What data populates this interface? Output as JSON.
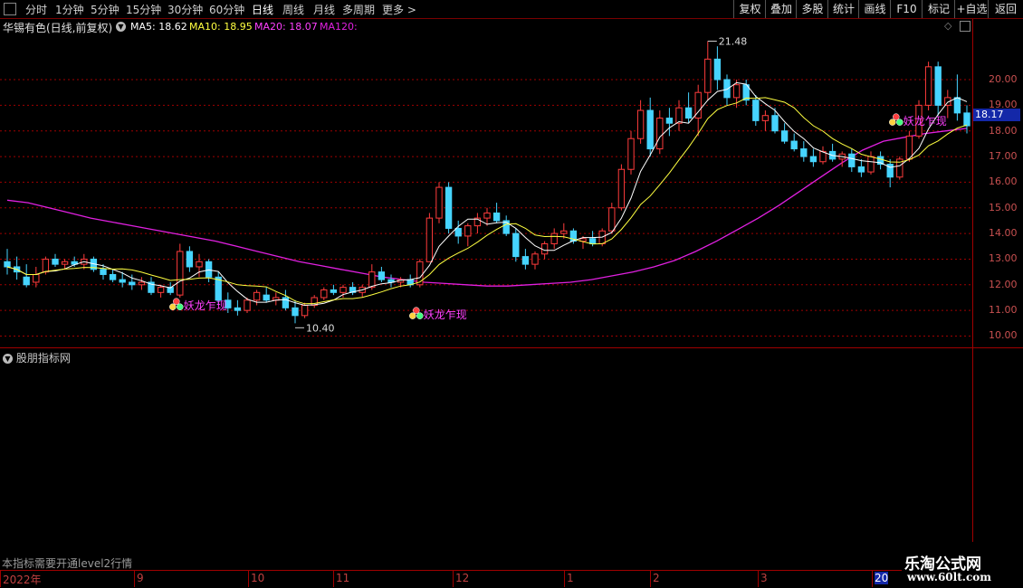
{
  "toolbar": {
    "timeframes": [
      "分时",
      "1分钟",
      "5分钟",
      "15分钟",
      "30分钟",
      "60分钟",
      "日线",
      "周线",
      "月线",
      "多周期",
      "更多 >"
    ],
    "active_timeframe": "日线",
    "buttons": [
      "复权",
      "叠加",
      "多股",
      "统计",
      "画线",
      "F10",
      "标记",
      "+自选",
      "返回"
    ]
  },
  "info": {
    "stock": "华锡有色(日线,前复权)",
    "ma5": "MA5: 18.62",
    "ma10": "MA10: 18.95",
    "ma20": "MA20: 18.07",
    "ma120": "MA120:"
  },
  "colors": {
    "up": "#ff3c3c",
    "down": "#46d4ff",
    "ma5": "#ffffff",
    "ma10": "#ffff40",
    "ma20": "#ff40ff",
    "ma120": "#e020e0",
    "grid": "#a00000"
  },
  "price_axis": {
    "ticks": [
      "20.00",
      "19.00",
      "18.00",
      "17.00",
      "16.00",
      "15.00",
      "14.00",
      "13.00",
      "12.00",
      "11.00",
      "10.00"
    ],
    "last_price": "18.17"
  },
  "annotations": {
    "high": "21.48",
    "low": "10.40",
    "signal_label": "妖龙乍现"
  },
  "subpanel": {
    "title": "股朋指标网",
    "note": "本指标需要开通level2行情"
  },
  "date_axis": [
    "2022年",
    "9",
    "10",
    "11",
    "12",
    "1",
    "2",
    "3",
    "20"
  ],
  "watermark": {
    "name": "乐淘公式网",
    "url": "www.60lt.com"
  },
  "chart_data": {
    "type": "candlestick",
    "ylim": [
      9.7,
      21.8
    ],
    "ma120": [
      15.3,
      15.2,
      15.0,
      14.8,
      14.6,
      14.45,
      14.3,
      14.15,
      14.0,
      13.85,
      13.7,
      13.5,
      13.3,
      13.1,
      12.9,
      12.75,
      12.6,
      12.45,
      12.3,
      12.2,
      12.1,
      12.05,
      12.0,
      11.95,
      11.95,
      12.0,
      12.05,
      12.1,
      12.2,
      12.35,
      12.5,
      12.7,
      12.95,
      13.3,
      13.7,
      14.15,
      14.6,
      15.1,
      15.65,
      16.2,
      16.75,
      17.25,
      17.6,
      17.75,
      17.9,
      18.0,
      18.1
    ],
    "candles": [
      {
        "o": 12.9,
        "h": 13.4,
        "l": 12.4,
        "c": 12.7
      },
      {
        "o": 12.7,
        "h": 13.1,
        "l": 12.2,
        "c": 12.5
      },
      {
        "o": 12.3,
        "h": 12.8,
        "l": 11.9,
        "c": 12.0
      },
      {
        "o": 12.1,
        "h": 12.7,
        "l": 11.9,
        "c": 12.4
      },
      {
        "o": 12.5,
        "h": 13.1,
        "l": 12.4,
        "c": 13.0
      },
      {
        "o": 13.0,
        "h": 13.2,
        "l": 12.7,
        "c": 12.8
      },
      {
        "o": 12.8,
        "h": 13.0,
        "l": 12.6,
        "c": 12.9
      },
      {
        "o": 12.9,
        "h": 13.1,
        "l": 12.7,
        "c": 12.8
      },
      {
        "o": 12.8,
        "h": 13.2,
        "l": 12.6,
        "c": 13.0
      },
      {
        "o": 13.0,
        "h": 13.1,
        "l": 12.5,
        "c": 12.6
      },
      {
        "o": 12.6,
        "h": 12.8,
        "l": 12.2,
        "c": 12.4
      },
      {
        "o": 12.4,
        "h": 12.6,
        "l": 12.1,
        "c": 12.2
      },
      {
        "o": 12.2,
        "h": 12.5,
        "l": 11.9,
        "c": 12.1
      },
      {
        "o": 12.1,
        "h": 12.4,
        "l": 11.8,
        "c": 12.0
      },
      {
        "o": 12.0,
        "h": 12.3,
        "l": 11.8,
        "c": 12.1
      },
      {
        "o": 12.1,
        "h": 12.3,
        "l": 11.6,
        "c": 11.7
      },
      {
        "o": 11.7,
        "h": 12.0,
        "l": 11.5,
        "c": 11.9
      },
      {
        "o": 11.9,
        "h": 12.1,
        "l": 11.6,
        "c": 11.7
      },
      {
        "o": 11.6,
        "h": 13.6,
        "l": 11.5,
        "c": 13.3
      },
      {
        "o": 13.3,
        "h": 13.5,
        "l": 12.5,
        "c": 12.7
      },
      {
        "o": 12.7,
        "h": 13.2,
        "l": 12.3,
        "c": 12.9
      },
      {
        "o": 12.9,
        "h": 13.0,
        "l": 12.1,
        "c": 12.3
      },
      {
        "o": 12.3,
        "h": 12.5,
        "l": 11.2,
        "c": 11.4
      },
      {
        "o": 11.4,
        "h": 11.7,
        "l": 10.9,
        "c": 11.1
      },
      {
        "o": 11.1,
        "h": 11.4,
        "l": 10.8,
        "c": 11.0
      },
      {
        "o": 11.0,
        "h": 11.5,
        "l": 10.9,
        "c": 11.4
      },
      {
        "o": 11.4,
        "h": 11.8,
        "l": 11.2,
        "c": 11.7
      },
      {
        "o": 11.6,
        "h": 11.9,
        "l": 11.3,
        "c": 11.4
      },
      {
        "o": 11.4,
        "h": 11.7,
        "l": 11.2,
        "c": 11.5
      },
      {
        "o": 11.5,
        "h": 11.8,
        "l": 11.0,
        "c": 11.1
      },
      {
        "o": 11.1,
        "h": 11.4,
        "l": 10.5,
        "c": 10.8
      },
      {
        "o": 10.8,
        "h": 11.3,
        "l": 10.7,
        "c": 11.2
      },
      {
        "o": 11.2,
        "h": 11.6,
        "l": 11.1,
        "c": 11.5
      },
      {
        "o": 11.5,
        "h": 11.9,
        "l": 11.4,
        "c": 11.8
      },
      {
        "o": 11.8,
        "h": 12.0,
        "l": 11.6,
        "c": 11.7
      },
      {
        "o": 11.7,
        "h": 12.0,
        "l": 11.5,
        "c": 11.9
      },
      {
        "o": 11.9,
        "h": 12.1,
        "l": 11.6,
        "c": 11.7
      },
      {
        "o": 11.7,
        "h": 12.0,
        "l": 11.5,
        "c": 11.9
      },
      {
        "o": 11.9,
        "h": 12.8,
        "l": 11.8,
        "c": 12.5
      },
      {
        "o": 12.5,
        "h": 12.7,
        "l": 12.1,
        "c": 12.2
      },
      {
        "o": 12.2,
        "h": 12.4,
        "l": 11.9,
        "c": 12.1
      },
      {
        "o": 12.1,
        "h": 12.3,
        "l": 11.9,
        "c": 12.2
      },
      {
        "o": 12.2,
        "h": 12.4,
        "l": 11.9,
        "c": 12.0
      },
      {
        "o": 12.0,
        "h": 13.0,
        "l": 11.9,
        "c": 12.9
      },
      {
        "o": 12.9,
        "h": 14.8,
        "l": 12.9,
        "c": 14.6
      },
      {
        "o": 14.6,
        "h": 16.0,
        "l": 14.4,
        "c": 15.8
      },
      {
        "o": 15.8,
        "h": 16.0,
        "l": 14.0,
        "c": 14.2
      },
      {
        "o": 14.2,
        "h": 14.5,
        "l": 13.6,
        "c": 13.9
      },
      {
        "o": 13.9,
        "h": 14.4,
        "l": 13.5,
        "c": 14.3
      },
      {
        "o": 14.3,
        "h": 14.8,
        "l": 14.0,
        "c": 14.6
      },
      {
        "o": 14.6,
        "h": 15.0,
        "l": 14.3,
        "c": 14.8
      },
      {
        "o": 14.8,
        "h": 15.2,
        "l": 14.4,
        "c": 14.5
      },
      {
        "o": 14.5,
        "h": 14.7,
        "l": 13.9,
        "c": 14.0
      },
      {
        "o": 14.0,
        "h": 14.2,
        "l": 12.9,
        "c": 13.1
      },
      {
        "o": 13.1,
        "h": 13.4,
        "l": 12.6,
        "c": 12.8
      },
      {
        "o": 12.8,
        "h": 13.3,
        "l": 12.6,
        "c": 13.2
      },
      {
        "o": 13.2,
        "h": 13.7,
        "l": 13.0,
        "c": 13.6
      },
      {
        "o": 13.6,
        "h": 14.2,
        "l": 13.4,
        "c": 14.0
      },
      {
        "o": 14.0,
        "h": 14.4,
        "l": 13.8,
        "c": 14.1
      },
      {
        "o": 14.1,
        "h": 14.2,
        "l": 13.6,
        "c": 13.7
      },
      {
        "o": 13.7,
        "h": 13.9,
        "l": 13.4,
        "c": 13.8
      },
      {
        "o": 13.8,
        "h": 14.1,
        "l": 13.5,
        "c": 13.6
      },
      {
        "o": 13.6,
        "h": 14.2,
        "l": 13.5,
        "c": 14.1
      },
      {
        "o": 14.1,
        "h": 15.2,
        "l": 14.0,
        "c": 15.0
      },
      {
        "o": 15.0,
        "h": 16.7,
        "l": 14.9,
        "c": 16.5
      },
      {
        "o": 16.5,
        "h": 18.0,
        "l": 16.3,
        "c": 17.7
      },
      {
        "o": 17.7,
        "h": 19.2,
        "l": 17.5,
        "c": 18.8
      },
      {
        "o": 18.8,
        "h": 19.3,
        "l": 17.0,
        "c": 17.3
      },
      {
        "o": 17.3,
        "h": 18.8,
        "l": 17.1,
        "c": 18.5
      },
      {
        "o": 18.5,
        "h": 18.9,
        "l": 17.8,
        "c": 18.3
      },
      {
        "o": 18.3,
        "h": 19.2,
        "l": 18.0,
        "c": 18.9
      },
      {
        "o": 18.9,
        "h": 19.5,
        "l": 18.3,
        "c": 18.5
      },
      {
        "o": 18.5,
        "h": 19.8,
        "l": 17.8,
        "c": 19.5
      },
      {
        "o": 19.5,
        "h": 21.5,
        "l": 19.2,
        "c": 20.8
      },
      {
        "o": 20.8,
        "h": 21.3,
        "l": 19.6,
        "c": 20.0
      },
      {
        "o": 20.0,
        "h": 20.2,
        "l": 19.0,
        "c": 19.3
      },
      {
        "o": 19.3,
        "h": 20.0,
        "l": 18.9,
        "c": 19.8
      },
      {
        "o": 19.8,
        "h": 20.0,
        "l": 19.0,
        "c": 19.2
      },
      {
        "o": 19.2,
        "h": 19.4,
        "l": 18.2,
        "c": 18.4
      },
      {
        "o": 18.4,
        "h": 18.8,
        "l": 18.0,
        "c": 18.6
      },
      {
        "o": 18.6,
        "h": 18.9,
        "l": 17.9,
        "c": 18.0
      },
      {
        "o": 18.0,
        "h": 18.3,
        "l": 17.5,
        "c": 17.6
      },
      {
        "o": 17.6,
        "h": 17.9,
        "l": 17.2,
        "c": 17.3
      },
      {
        "o": 17.3,
        "h": 17.6,
        "l": 16.8,
        "c": 17.0
      },
      {
        "o": 17.0,
        "h": 17.3,
        "l": 16.6,
        "c": 16.8
      },
      {
        "o": 16.8,
        "h": 17.4,
        "l": 16.7,
        "c": 17.2
      },
      {
        "o": 17.2,
        "h": 17.5,
        "l": 16.8,
        "c": 16.9
      },
      {
        "o": 16.9,
        "h": 17.2,
        "l": 16.6,
        "c": 17.1
      },
      {
        "o": 17.1,
        "h": 17.3,
        "l": 16.4,
        "c": 16.6
      },
      {
        "o": 16.6,
        "h": 16.9,
        "l": 16.2,
        "c": 16.4
      },
      {
        "o": 16.4,
        "h": 17.2,
        "l": 16.3,
        "c": 17.0
      },
      {
        "o": 17.0,
        "h": 17.2,
        "l": 16.5,
        "c": 16.7
      },
      {
        "o": 16.7,
        "h": 16.9,
        "l": 15.8,
        "c": 16.2
      },
      {
        "o": 16.2,
        "h": 17.0,
        "l": 16.1,
        "c": 16.9
      },
      {
        "o": 16.9,
        "h": 18.0,
        "l": 16.8,
        "c": 17.8
      },
      {
        "o": 17.8,
        "h": 19.2,
        "l": 17.7,
        "c": 19.0
      },
      {
        "o": 19.0,
        "h": 20.7,
        "l": 18.8,
        "c": 20.5
      },
      {
        "o": 20.5,
        "h": 20.7,
        "l": 18.6,
        "c": 19.0
      },
      {
        "o": 19.0,
        "h": 19.6,
        "l": 18.5,
        "c": 19.3
      },
      {
        "o": 19.3,
        "h": 20.2,
        "l": 18.4,
        "c": 18.7
      },
      {
        "o": 18.7,
        "h": 19.0,
        "l": 17.9,
        "c": 18.2
      }
    ]
  }
}
